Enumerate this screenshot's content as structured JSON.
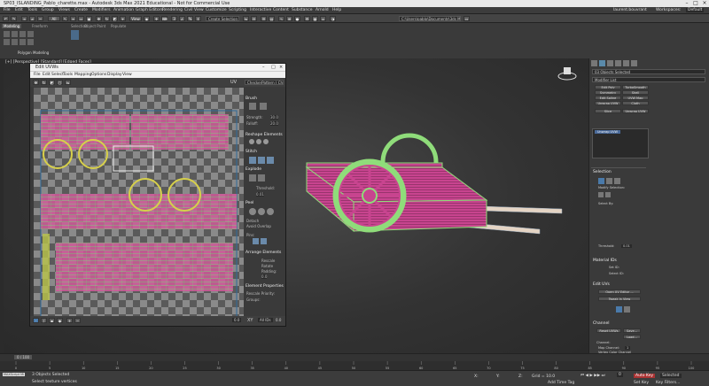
{
  "window": {
    "title": "SP03_ISLANDING_Pablo_charette.max - Autodesk 3ds Max 2021 Educational - Not for Commercial Use",
    "user": "laurent.bouvrant",
    "workspace_label": "Workspaces:",
    "workspace_value": "Default"
  },
  "menu": [
    "File",
    "Edit",
    "Tools",
    "Group",
    "Views",
    "Create",
    "Modifiers",
    "Animation",
    "Graph Editors",
    "Rendering",
    "Civil View",
    "Customize",
    "Scripting",
    "Interactive",
    "Content",
    "Substance",
    "Arnold",
    "Help"
  ],
  "toolbar": {
    "selection_set": "Create Selection Se",
    "path": "C:\\Users\\pablo\\Documents\\3ds Max 2021"
  },
  "ribbon": {
    "tabs": [
      "Modeling",
      "Freeform",
      "Selection",
      "Object Paint",
      "Populate"
    ],
    "sub": "Polygon Modeling"
  },
  "viewport": {
    "label": "[+] [Perspective] [Standard] [Edged Faces]"
  },
  "uv_editor": {
    "title": "Edit UVWs",
    "menu": [
      "File",
      "Edit",
      "Select",
      "Tools",
      "Mapping",
      "Options",
      "Display",
      "View"
    ],
    "uv_label": "UV",
    "channel_dd": "CheckerPattern  ( Checker )",
    "sections": [
      "Brush",
      "Reshape Elements",
      "Stitch",
      "Explode",
      "Peel",
      "Arrange Elements",
      "Element Properties"
    ],
    "strength_label": "Strength:",
    "strength_value": "30.0",
    "falloff_label": "Falloff:",
    "falloff_value": "20.0",
    "threshold_label": "Threshold:",
    "threshold_value": "0.01",
    "detach": "Detach",
    "avoid_overlap": "Avoid Overlap",
    "pins": "Pins:",
    "rescale": "Rescale",
    "rotate": "Rotate",
    "padding_label": "Padding:",
    "padding_value": "0.0",
    "rescale_priority": "Rescale Priority:",
    "groups": "Groups:",
    "zoom_value": "0.0",
    "xy": "XY",
    "all_ids": "All IDs",
    "coord_value": "0.0"
  },
  "command_panel": {
    "object_name": "03 Objects Selected",
    "modifier_list": "Modifier List",
    "buttons": [
      "Edit Poly",
      "TurboSmooth",
      "Symmetry",
      "Shell",
      "Edit Spline",
      "UVW Map",
      "Unwrap UVW",
      "Cloth",
      "Slice",
      "Unwrap UVW"
    ],
    "stack_item": "Unwrap UVW",
    "selection_title": "Selection",
    "modify_selection": "Modify Selection:",
    "select_by": "Select By:",
    "threshold_label": "Threshold:",
    "threshold_value": "0.01",
    "material_ids": "Material IDs",
    "set_id": "Set ID:",
    "select_id": "Select ID:",
    "edit_uvs": "Edit UVs",
    "open_uv_editor": "Open UV Editor ...",
    "tweak_in_view": "Tweak In View",
    "channel_title": "Channel",
    "reset_uvws": "Reset UVWs",
    "save": "Save...",
    "load": "Load...",
    "channel_label": "Channel:",
    "map_channel": "Map Channel:",
    "map_channel_value": "1",
    "vertex_color": "Vertex Color Channel"
  },
  "time": {
    "frame": "0 / 100",
    "ticks": [
      "0",
      "5",
      "10",
      "15",
      "20",
      "25",
      "30",
      "35",
      "40",
      "45",
      "50",
      "55",
      "60",
      "65",
      "70",
      "75",
      "80",
      "85",
      "90",
      "95",
      "100"
    ]
  },
  "status": {
    "selected": "3 Objects Selected",
    "prompt": "Select texture vertices",
    "script": "MAXScript Mi",
    "x": "X:",
    "y": "Y:",
    "z": "Z:",
    "grid": "Grid = 10.0",
    "autokey": "Auto Key",
    "selected_dd": "Selected",
    "setkey": "Set Key",
    "keyfilters": "Key Filters...",
    "add_time_tag": "Add Time Tag",
    "frame_field": "0"
  }
}
